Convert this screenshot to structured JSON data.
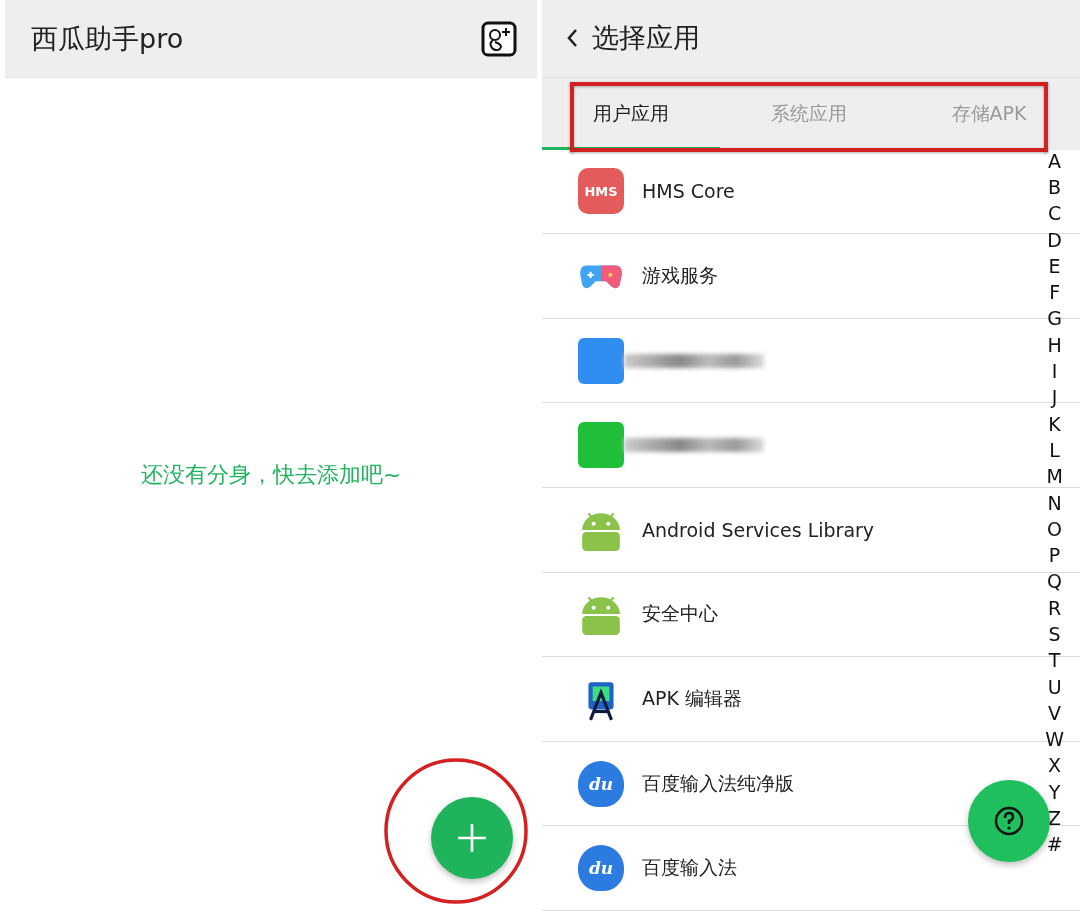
{
  "left": {
    "title": "西瓜助手pro",
    "empty_message": "还没有分身，快去添加吧~"
  },
  "right": {
    "title": "选择应用",
    "tabs": [
      {
        "label": "用户应用",
        "selected": true
      },
      {
        "label": "系统应用",
        "selected": false
      },
      {
        "label": "存储APK",
        "selected": false
      }
    ],
    "apps": [
      {
        "kind": "hms",
        "icon_text": "HMS",
        "name": "HMS Core"
      },
      {
        "kind": "game",
        "name": "游戏服务"
      },
      {
        "kind": "blurred",
        "color": "#2f8ef0"
      },
      {
        "kind": "blurred",
        "color": "#1fbf3a"
      },
      {
        "kind": "android",
        "name": "Android Services Library"
      },
      {
        "kind": "android",
        "name": "安全中心"
      },
      {
        "kind": "apk",
        "name": "APK 编辑器"
      },
      {
        "kind": "baidu",
        "icon_text": "du",
        "name": "百度输入法纯净版"
      },
      {
        "kind": "baidu",
        "icon_text": "du",
        "name": "百度输入法"
      }
    ],
    "index": [
      "A",
      "B",
      "C",
      "D",
      "E",
      "F",
      "G",
      "H",
      "I",
      "J",
      "K",
      "L",
      "M",
      "N",
      "O",
      "P",
      "Q",
      "R",
      "S",
      "T",
      "U",
      "V",
      "W",
      "X",
      "Y",
      "Z",
      "#"
    ]
  }
}
